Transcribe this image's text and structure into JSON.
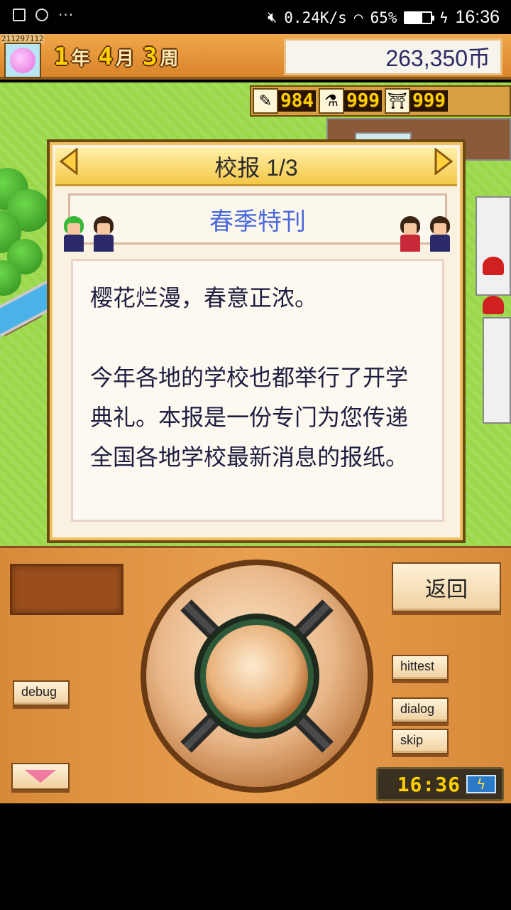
{
  "status_bar": {
    "network_speed": "0.24K/s",
    "battery_percent": "65%",
    "battery_level": 0.65,
    "time": "16:36",
    "icons": [
      "image-icon",
      "chat-icon",
      "more-icon",
      "mute-icon",
      "wifi-icon",
      "battery-icon",
      "charging-icon"
    ]
  },
  "top_bar": {
    "debug_id": "211297112",
    "date": {
      "year": "1",
      "year_unit": "年",
      "month": "4",
      "month_unit": "月",
      "week": "3",
      "week_unit": "周"
    },
    "money": "263,350币"
  },
  "resources": [
    {
      "icon": "pencil-icon",
      "glyph": "✎",
      "value": "984"
    },
    {
      "icon": "flask-icon",
      "glyph": "⚗",
      "value": "999"
    },
    {
      "icon": "bell-icon",
      "glyph": "⛩",
      "value": "999"
    }
  ],
  "dialog": {
    "title": "校报 1/3",
    "subtitle": "春季特刊",
    "paragraphs": [
      "樱花烂漫，春意正浓。",
      "今年各地的学校也都举行了开学典礼。本报是一份专门为您传递全国各地学校最新消息的报纸。"
    ]
  },
  "panel": {
    "back_label": "返回",
    "hittest_label": "hittest",
    "debug_label": "debug",
    "dialog_label": "dialog",
    "skip_label": "skip",
    "clock": "16:36",
    "accent": "#e8a050"
  }
}
